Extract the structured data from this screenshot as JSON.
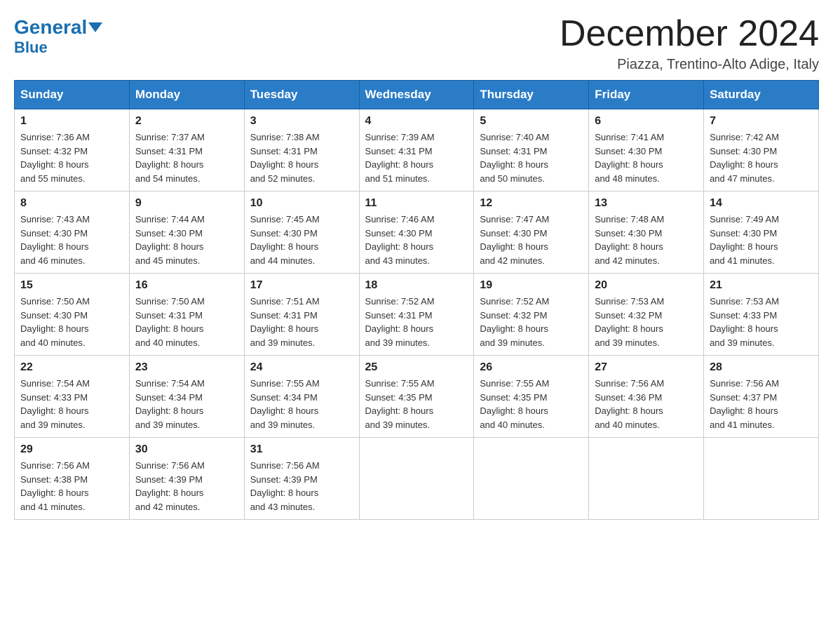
{
  "header": {
    "logo_general": "General",
    "logo_blue": "Blue",
    "main_title": "December 2024",
    "subtitle": "Piazza, Trentino-Alto Adige, Italy"
  },
  "days_of_week": [
    "Sunday",
    "Monday",
    "Tuesday",
    "Wednesday",
    "Thursday",
    "Friday",
    "Saturday"
  ],
  "weeks": [
    [
      {
        "day": "1",
        "sunrise": "7:36 AM",
        "sunset": "4:32 PM",
        "daylight": "8 hours and 55 minutes."
      },
      {
        "day": "2",
        "sunrise": "7:37 AM",
        "sunset": "4:31 PM",
        "daylight": "8 hours and 54 minutes."
      },
      {
        "day": "3",
        "sunrise": "7:38 AM",
        "sunset": "4:31 PM",
        "daylight": "8 hours and 52 minutes."
      },
      {
        "day": "4",
        "sunrise": "7:39 AM",
        "sunset": "4:31 PM",
        "daylight": "8 hours and 51 minutes."
      },
      {
        "day": "5",
        "sunrise": "7:40 AM",
        "sunset": "4:31 PM",
        "daylight": "8 hours and 50 minutes."
      },
      {
        "day": "6",
        "sunrise": "7:41 AM",
        "sunset": "4:30 PM",
        "daylight": "8 hours and 48 minutes."
      },
      {
        "day": "7",
        "sunrise": "7:42 AM",
        "sunset": "4:30 PM",
        "daylight": "8 hours and 47 minutes."
      }
    ],
    [
      {
        "day": "8",
        "sunrise": "7:43 AM",
        "sunset": "4:30 PM",
        "daylight": "8 hours and 46 minutes."
      },
      {
        "day": "9",
        "sunrise": "7:44 AM",
        "sunset": "4:30 PM",
        "daylight": "8 hours and 45 minutes."
      },
      {
        "day": "10",
        "sunrise": "7:45 AM",
        "sunset": "4:30 PM",
        "daylight": "8 hours and 44 minutes."
      },
      {
        "day": "11",
        "sunrise": "7:46 AM",
        "sunset": "4:30 PM",
        "daylight": "8 hours and 43 minutes."
      },
      {
        "day": "12",
        "sunrise": "7:47 AM",
        "sunset": "4:30 PM",
        "daylight": "8 hours and 42 minutes."
      },
      {
        "day": "13",
        "sunrise": "7:48 AM",
        "sunset": "4:30 PM",
        "daylight": "8 hours and 42 minutes."
      },
      {
        "day": "14",
        "sunrise": "7:49 AM",
        "sunset": "4:30 PM",
        "daylight": "8 hours and 41 minutes."
      }
    ],
    [
      {
        "day": "15",
        "sunrise": "7:50 AM",
        "sunset": "4:30 PM",
        "daylight": "8 hours and 40 minutes."
      },
      {
        "day": "16",
        "sunrise": "7:50 AM",
        "sunset": "4:31 PM",
        "daylight": "8 hours and 40 minutes."
      },
      {
        "day": "17",
        "sunrise": "7:51 AM",
        "sunset": "4:31 PM",
        "daylight": "8 hours and 39 minutes."
      },
      {
        "day": "18",
        "sunrise": "7:52 AM",
        "sunset": "4:31 PM",
        "daylight": "8 hours and 39 minutes."
      },
      {
        "day": "19",
        "sunrise": "7:52 AM",
        "sunset": "4:32 PM",
        "daylight": "8 hours and 39 minutes."
      },
      {
        "day": "20",
        "sunrise": "7:53 AM",
        "sunset": "4:32 PM",
        "daylight": "8 hours and 39 minutes."
      },
      {
        "day": "21",
        "sunrise": "7:53 AM",
        "sunset": "4:33 PM",
        "daylight": "8 hours and 39 minutes."
      }
    ],
    [
      {
        "day": "22",
        "sunrise": "7:54 AM",
        "sunset": "4:33 PM",
        "daylight": "8 hours and 39 minutes."
      },
      {
        "day": "23",
        "sunrise": "7:54 AM",
        "sunset": "4:34 PM",
        "daylight": "8 hours and 39 minutes."
      },
      {
        "day": "24",
        "sunrise": "7:55 AM",
        "sunset": "4:34 PM",
        "daylight": "8 hours and 39 minutes."
      },
      {
        "day": "25",
        "sunrise": "7:55 AM",
        "sunset": "4:35 PM",
        "daylight": "8 hours and 39 minutes."
      },
      {
        "day": "26",
        "sunrise": "7:55 AM",
        "sunset": "4:35 PM",
        "daylight": "8 hours and 40 minutes."
      },
      {
        "day": "27",
        "sunrise": "7:56 AM",
        "sunset": "4:36 PM",
        "daylight": "8 hours and 40 minutes."
      },
      {
        "day": "28",
        "sunrise": "7:56 AM",
        "sunset": "4:37 PM",
        "daylight": "8 hours and 41 minutes."
      }
    ],
    [
      {
        "day": "29",
        "sunrise": "7:56 AM",
        "sunset": "4:38 PM",
        "daylight": "8 hours and 41 minutes."
      },
      {
        "day": "30",
        "sunrise": "7:56 AM",
        "sunset": "4:39 PM",
        "daylight": "8 hours and 42 minutes."
      },
      {
        "day": "31",
        "sunrise": "7:56 AM",
        "sunset": "4:39 PM",
        "daylight": "8 hours and 43 minutes."
      },
      null,
      null,
      null,
      null
    ]
  ],
  "labels": {
    "sunrise": "Sunrise:",
    "sunset": "Sunset:",
    "daylight": "Daylight:"
  }
}
